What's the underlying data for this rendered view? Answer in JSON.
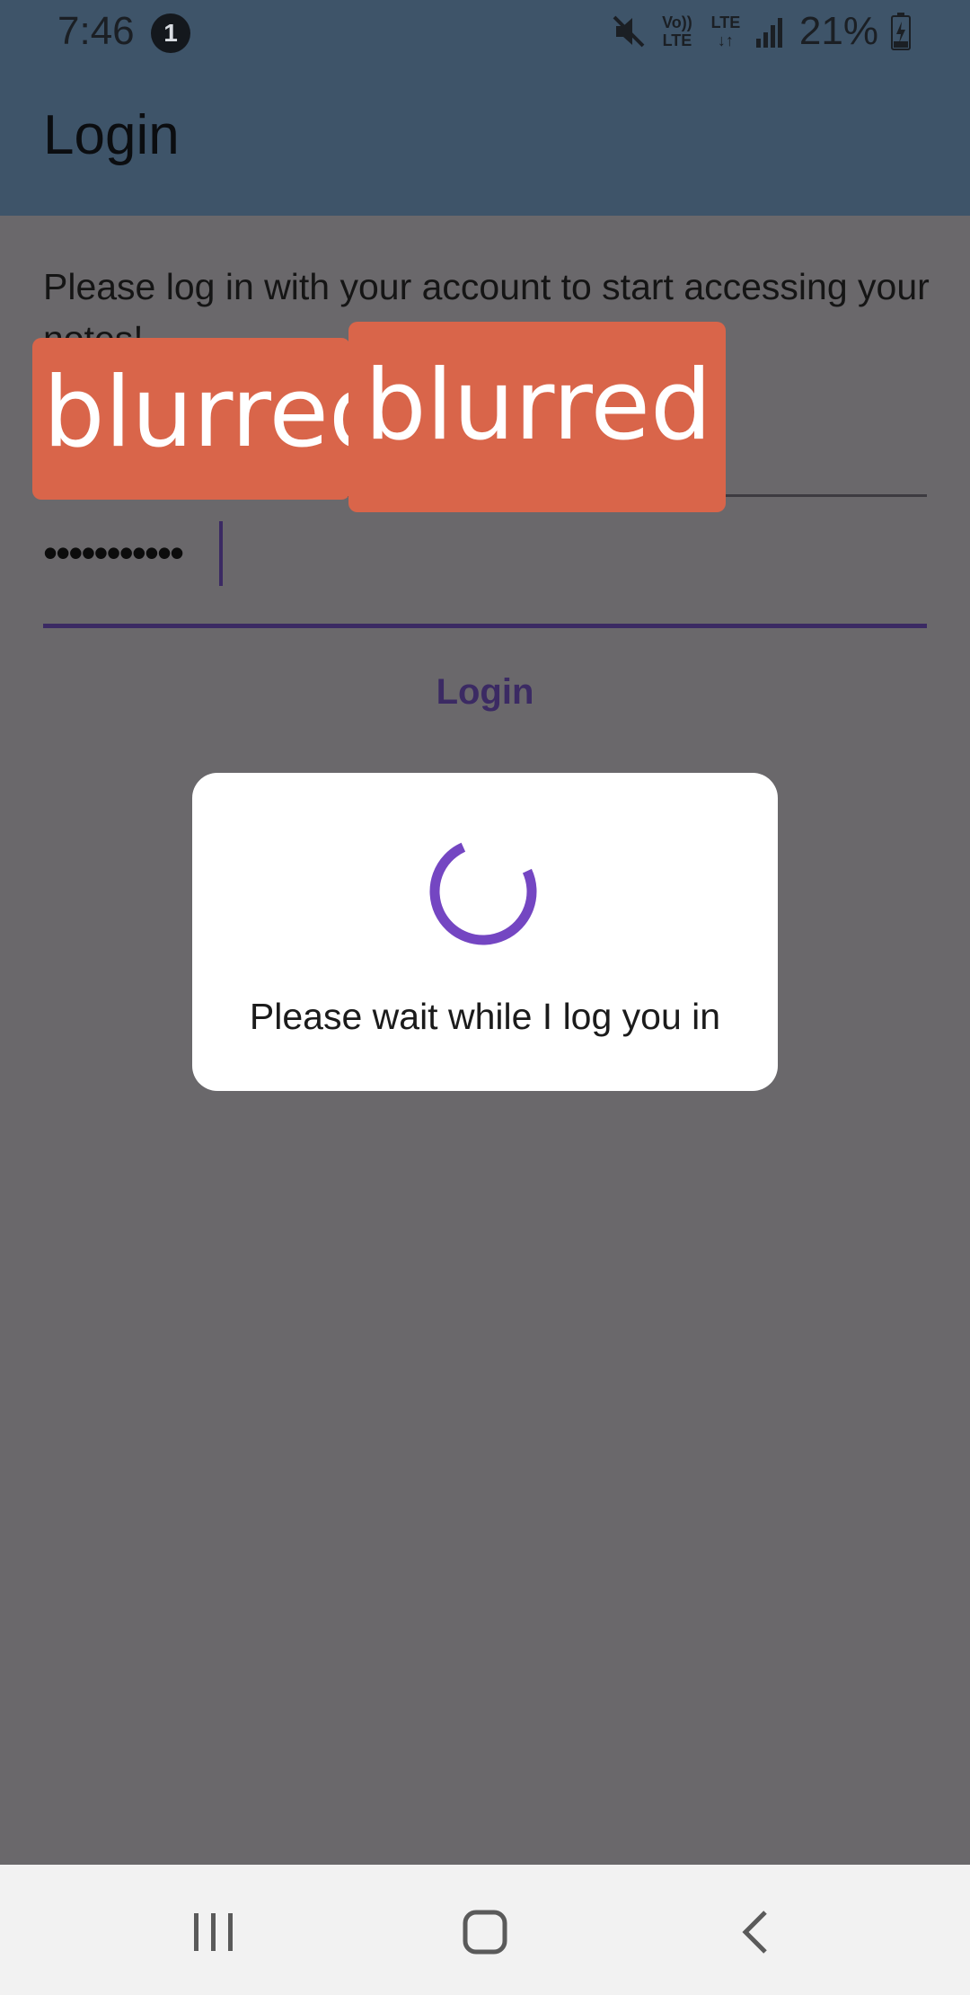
{
  "status_bar": {
    "time": "7:46",
    "notification_count": "1",
    "network_volte": "Vo)) LTE",
    "network_lte": "LTE",
    "battery": "21%",
    "icons": [
      "mute-icon",
      "volte-icon",
      "lte-data-icon",
      "signal-icon",
      "battery-charging-icon"
    ]
  },
  "app_bar": {
    "title": "Login"
  },
  "form": {
    "intro_text": "Please log in with your account to start accessing your notes!",
    "redaction_1": "blurred",
    "redaction_2": "blurred",
    "password_value": "•••••••••••",
    "login_label": "Login"
  },
  "dialog": {
    "message": "Please wait while I log you in",
    "spinner_color": "#7446c2"
  },
  "nav_bar": {
    "buttons": [
      "recents-icon",
      "home-icon",
      "back-icon"
    ]
  },
  "colors": {
    "app_bar": "#3e5469",
    "scrim_bg": "#6a686b",
    "accent": "#3b2a63",
    "redaction": "#d9654a"
  }
}
